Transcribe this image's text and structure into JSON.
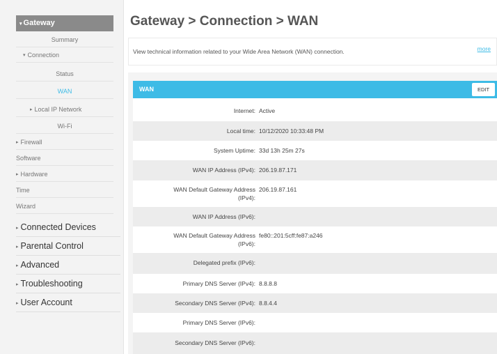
{
  "page_title": "Gateway > Connection > WAN",
  "sidebar": {
    "gateway": "Gateway",
    "items": [
      {
        "label": "Summary"
      },
      {
        "label": "Connection"
      },
      {
        "label": "Status"
      },
      {
        "label": "WAN"
      },
      {
        "label": "Local IP Network"
      },
      {
        "label": "Wi-Fi"
      },
      {
        "label": "Firewall"
      },
      {
        "label": "Software"
      },
      {
        "label": "Hardware"
      },
      {
        "label": "Time"
      },
      {
        "label": "Wizard"
      }
    ],
    "sections": [
      {
        "label": "Connected Devices"
      },
      {
        "label": "Parental Control"
      },
      {
        "label": "Advanced"
      },
      {
        "label": "Troubleshooting"
      },
      {
        "label": "User Account"
      }
    ]
  },
  "info": {
    "text": "View technical information related to your Wide Area Network (WAN) connection.",
    "more": "more"
  },
  "panel": {
    "title": "WAN",
    "edit": "EDIT"
  },
  "rows": [
    {
      "label": "Internet:",
      "value": "Active"
    },
    {
      "label": "Local time:",
      "value": "10/12/2020 10:33:48 PM"
    },
    {
      "label": "System Uptime:",
      "value": "33d 13h 25m 27s"
    },
    {
      "label": "WAN IP Address (IPv4):",
      "value": "206.19.87.171"
    },
    {
      "label": "WAN Default Gateway Address",
      "label2": "(IPv4):",
      "value": "206.19.87.161"
    },
    {
      "label": "WAN IP Address (IPv6):",
      "value": ""
    },
    {
      "label": "WAN Default Gateway Address",
      "label2": "(IPv6):",
      "value": "fe80::201:5cff:fe87:a246"
    },
    {
      "label": "Delegated prefix (IPv6):",
      "value": ""
    },
    {
      "label": "Primary DNS Server (IPv4):",
      "value": "8.8.8.8"
    },
    {
      "label": "Secondary DNS Server (IPv4):",
      "value": "8.8.4.4"
    },
    {
      "label": "Primary DNS Server (IPv6):",
      "value": ""
    },
    {
      "label": "Secondary DNS Server (IPv6):",
      "value": ""
    }
  ],
  "colors": {
    "accent": "#3dbbe6",
    "sidebar_active": "#8a8a8a"
  }
}
